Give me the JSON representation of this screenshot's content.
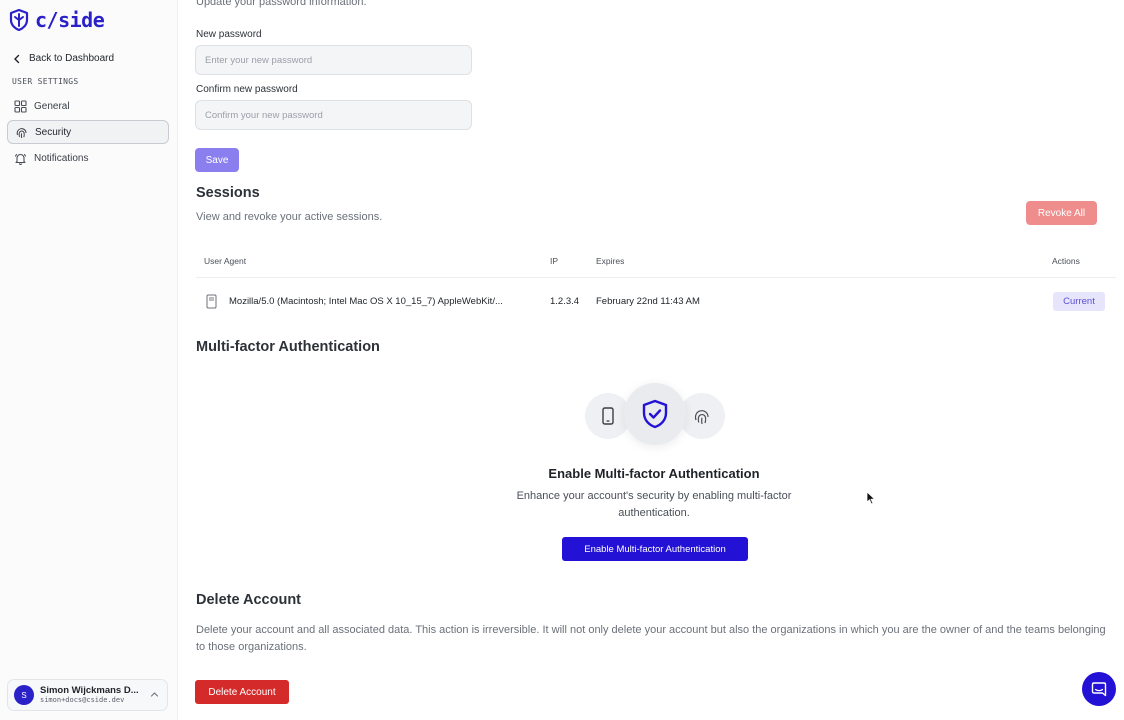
{
  "brand": {
    "name": "c/side",
    "color": "#2b21c8"
  },
  "sidebar": {
    "back_label": "Back to Dashboard",
    "section_label": "USER SETTINGS",
    "items": [
      {
        "label": "General",
        "icon": "grid-icon",
        "active": false
      },
      {
        "label": "Security",
        "icon": "fingerprint-icon",
        "active": true
      },
      {
        "label": "Notifications",
        "icon": "bell-icon",
        "active": false
      }
    ],
    "user": {
      "initial": "S",
      "name": "Simon Wijckmans D...",
      "email": "simon+docs@cside.dev"
    }
  },
  "password": {
    "description": "Update your password information.",
    "new_label": "New password",
    "new_placeholder": "Enter your new password",
    "confirm_label": "Confirm new password",
    "confirm_placeholder": "Confirm your new password",
    "save_label": "Save"
  },
  "sessions": {
    "title": "Sessions",
    "description": "View and revoke your active sessions.",
    "revoke_all_label": "Revoke All",
    "columns": [
      "User Agent",
      "IP",
      "Expires",
      "Actions"
    ],
    "rows": [
      {
        "user_agent": "Mozilla/5.0 (Macintosh; Intel Mac OS X 10_15_7) AppleWebKit/...",
        "ip": "1.2.3.4",
        "expires": "February 22nd 11:43 AM",
        "action": "Current"
      }
    ]
  },
  "mfa": {
    "title": "Multi-factor Authentication",
    "heading": "Enable Multi-factor Authentication",
    "description": "Enhance your account's security by enabling multi-factor authentication.",
    "button_label": "Enable Multi-factor Authentication"
  },
  "delete_account": {
    "title": "Delete Account",
    "description": "Delete your account and all associated data. This action is irreversible. It will not only delete your account but also the organizations in which you are the owner of and the teams belonging to those organizations.",
    "button_label": "Delete Account"
  },
  "colors": {
    "accent": "#2411d6",
    "save_button": "#8b7ff0",
    "revoke_button": "#ef8d8d",
    "delete_button": "#d42a2a",
    "current_badge_bg": "#e7e5fb"
  }
}
